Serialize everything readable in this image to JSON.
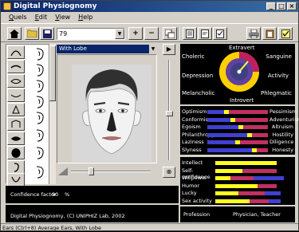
{
  "window": {
    "title": "Digital Physiognomy"
  },
  "menu": [
    "Quels",
    "Edit",
    "View",
    "Help"
  ],
  "toolbar": {
    "combo_value": "79"
  },
  "feature_panel": {
    "selected_feature": "With Lobe"
  },
  "temperament": {
    "top": "Extravert",
    "bottom": "Introvert",
    "left_top": "Choleric",
    "right_top": "Sanguine",
    "left_mid": "Depression",
    "right_mid": "Activity",
    "left_bottom": "Melancholic",
    "right_bottom": "Phlegmatic"
  },
  "traits": [
    {
      "left": "Optimism",
      "right": "Pessimism",
      "value": 0.32
    },
    {
      "left": "Conformism",
      "right": "Adventurism",
      "value": 0.42
    },
    {
      "left": "Egoism",
      "right": "Altruism",
      "value": 0.55
    },
    {
      "left": "Philanthropy",
      "right": "Hostility",
      "value": 0.7
    },
    {
      "left": "Laziness",
      "right": "Diligence",
      "value": 0.5
    },
    {
      "left": "Slyness",
      "right": "Honesty",
      "value": 0.78
    }
  ],
  "abilities": [
    {
      "label": "Intellect",
      "yellow": 0.8,
      "red": 0.0,
      "blue": 0.0
    },
    {
      "label": "Self-confidence",
      "yellow": 0.35,
      "red": 0.45,
      "blue": 0.0
    },
    {
      "label": "Willpower",
      "yellow": 0.2,
      "red": 0.3,
      "blue": 0.4
    },
    {
      "label": "Humor",
      "yellow": 0.55,
      "red": 0.25,
      "blue": 0.0
    },
    {
      "label": "Lucky",
      "yellow": 0.3,
      "red": 0.35,
      "blue": 0.2
    },
    {
      "label": "Sex activity",
      "yellow": 0.45,
      "red": 0.25,
      "blue": 0.15
    }
  ],
  "profession": {
    "label": "Profession",
    "value": "Physician, Teacher"
  },
  "confidence": {
    "label": "Confidence factor",
    "value": "90",
    "unit": "%"
  },
  "copyright": "Digital Physiognomy, (C) UNIPHIZ Lab, 2002",
  "status": "Ears (Ctrl+8) Average Ears, With Lobe",
  "colors": {
    "title_start": "#0a246a",
    "title_end": "#3a6ea5",
    "bar_red": "#c03060",
    "bar_blue": "#4040d0",
    "bar_yellow": "#ffff20"
  }
}
